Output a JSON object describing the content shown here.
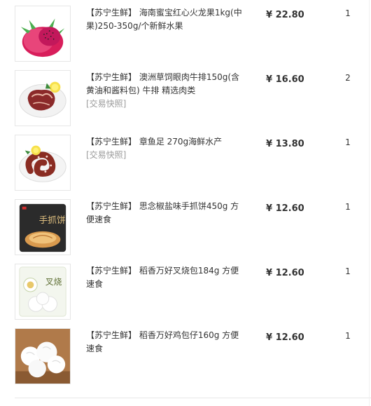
{
  "items": [
    {
      "title": "【苏宁生鲜】 海南蜜宝红心火龙果1kg(中果)250-350g/个新鲜水果",
      "snapshot": "",
      "price": "¥ 22.80",
      "qty": "1"
    },
    {
      "title": "【苏宁生鲜】 澳洲草饲眼肉牛排150g(含黄油和酱料包) 牛排 精选肉类",
      "snapshot": "[交易快照]",
      "price": "¥ 16.60",
      "qty": "2"
    },
    {
      "title": "【苏宁生鲜】 章鱼足 270g海鲜水产",
      "snapshot": "[交易快照]",
      "price": "¥ 13.80",
      "qty": "1"
    },
    {
      "title": "【苏宁生鲜】 思念椒盐味手抓饼450g 方便速食",
      "snapshot": "",
      "price": "¥ 12.60",
      "qty": "1"
    },
    {
      "title": "【苏宁生鲜】 稻香万好叉烧包184g 方便速食",
      "snapshot": "",
      "price": "¥ 12.60",
      "qty": "1"
    },
    {
      "title": "【苏宁生鲜】 稻香万好鸡包仔160g 方便速食",
      "snapshot": "",
      "price": "¥ 12.60",
      "qty": "1"
    }
  ],
  "thumb_labels": {
    "pancake": "手抓饼",
    "bun": "叉烧"
  },
  "colors": {
    "price": "#333333",
    "snapshot": "#999999",
    "text": "#333333",
    "border": "#e6e6e6"
  }
}
